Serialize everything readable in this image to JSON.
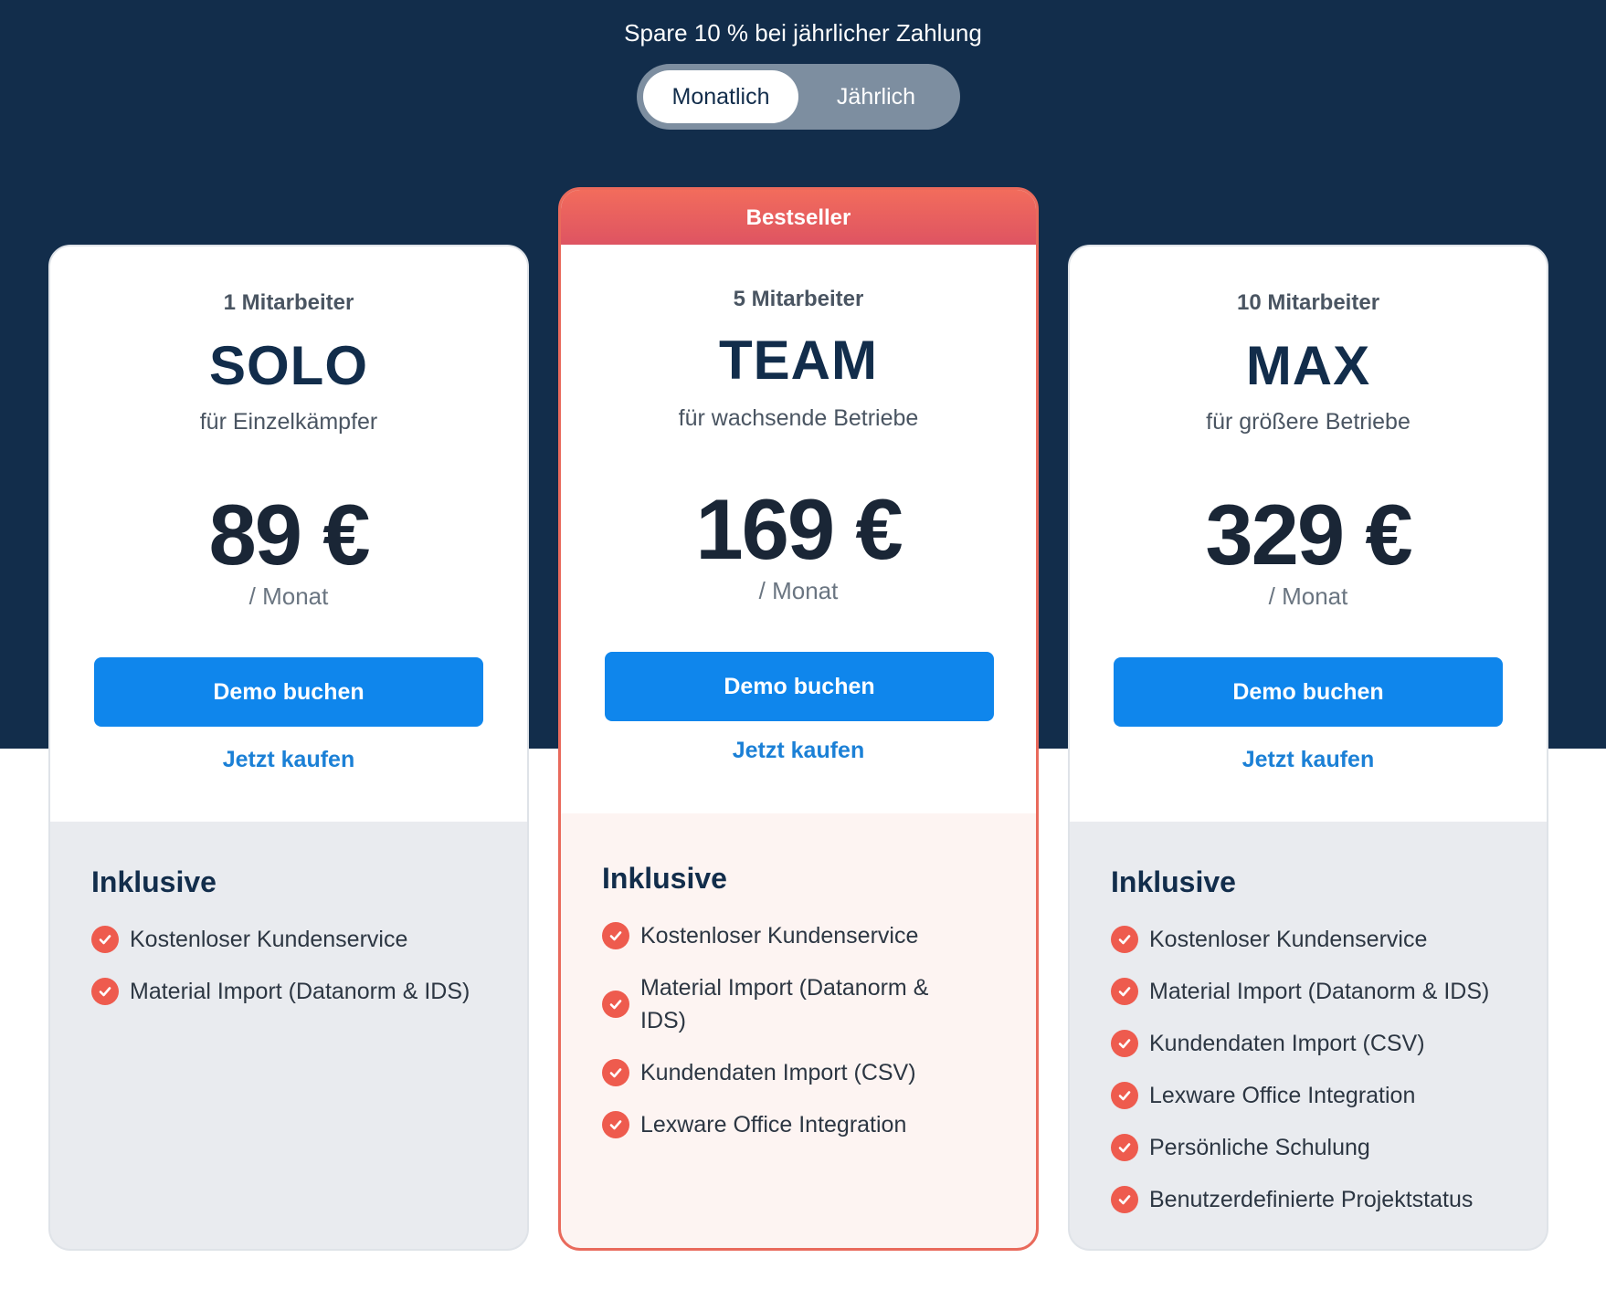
{
  "promo_text": "Spare 10 % bei jährlicher Zahlung",
  "billing_toggle": {
    "options": [
      "Monatlich",
      "Jährlich"
    ],
    "selected": "Monatlich"
  },
  "colors": {
    "navy": "#122d4b",
    "accent_blue": "#0f86ec",
    "accent_red": "#ee5b4e"
  },
  "plans": [
    {
      "employees": "1 Mitarbeiter",
      "name": "SOLO",
      "description": "für Einzelkämpfer",
      "price": "89 €",
      "period": "/ Monat",
      "demo_label": "Demo buchen",
      "buy_label": "Jetzt kaufen",
      "included_title": "Inklusive",
      "features": [
        "Kostenloser Kundenservice",
        "Material Import (Datanorm & IDS)"
      ]
    },
    {
      "badge": "Bestseller",
      "employees": "5 Mitarbeiter",
      "name": "TEAM",
      "description": "für wachsende Betriebe",
      "price": "169 €",
      "period": "/ Monat",
      "demo_label": "Demo buchen",
      "buy_label": "Jetzt kaufen",
      "included_title": "Inklusive",
      "features": [
        "Kostenloser Kundenservice",
        "Material Import (Datanorm & IDS)",
        "Kundendaten Import (CSV)",
        "Lexware Office Integration"
      ]
    },
    {
      "employees": "10 Mitarbeiter",
      "name": "MAX",
      "description": "für größere Betriebe",
      "price": "329 €",
      "period": "/ Monat",
      "demo_label": "Demo buchen",
      "buy_label": "Jetzt kaufen",
      "included_title": "Inklusive",
      "features": [
        "Kostenloser Kundenservice",
        "Material Import (Datanorm & IDS)",
        "Kundendaten Import (CSV)",
        "Lexware Office Integration",
        "Persönliche Schulung",
        "Benutzerdefinierte Projektstatus"
      ]
    }
  ]
}
